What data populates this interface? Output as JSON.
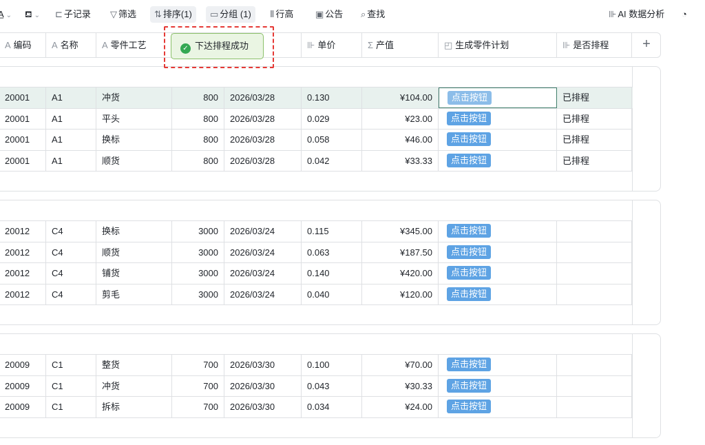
{
  "toolbar": {
    "fill_label": "",
    "subrecord": "子记录",
    "filter": "筛选",
    "sort": "排序(1)",
    "group": "分组 (1)",
    "row_height": "行高",
    "notice": "公告",
    "search": "查找",
    "ai": "AI 数据分析"
  },
  "columns": [
    {
      "icon": "A",
      "label": "编码"
    },
    {
      "icon": "A",
      "label": "名称"
    },
    {
      "icon": "A",
      "label": "零件工艺"
    },
    {
      "icon": "",
      "label": ""
    },
    {
      "icon": "",
      "label": ""
    },
    {
      "icon": "⊪",
      "label": "单价"
    },
    {
      "icon": "Σ",
      "label": "产值"
    },
    {
      "icon": "◰",
      "label": "生成零件计划"
    },
    {
      "icon": "⊪",
      "label": "是否排程"
    }
  ],
  "toast": {
    "text": "下达排程成功"
  },
  "groups": [
    {
      "rows": [
        {
          "code": "20001",
          "name": "A1",
          "process": "冲货",
          "qty": "800",
          "date": "2026/03/28",
          "price": "0.130",
          "value": "¥104.00",
          "button": "点击按钮",
          "status": "已排程"
        },
        {
          "code": "20001",
          "name": "A1",
          "process": "平头",
          "qty": "800",
          "date": "2026/03/28",
          "price": "0.029",
          "value": "¥23.00",
          "button": "点击按钮",
          "status": "已排程"
        },
        {
          "code": "20001",
          "name": "A1",
          "process": "换标",
          "qty": "800",
          "date": "2026/03/28",
          "price": "0.058",
          "value": "¥46.00",
          "button": "点击按钮",
          "status": "已排程"
        },
        {
          "code": "20001",
          "name": "A1",
          "process": "顺货",
          "qty": "800",
          "date": "2026/03/28",
          "price": "0.042",
          "value": "¥33.33",
          "button": "点击按钮",
          "status": "已排程"
        }
      ]
    },
    {
      "rows": [
        {
          "code": "20012",
          "name": "C4",
          "process": "换标",
          "qty": "3000",
          "date": "2026/03/24",
          "price": "0.115",
          "value": "¥345.00",
          "button": "点击按钮",
          "status": ""
        },
        {
          "code": "20012",
          "name": "C4",
          "process": "顺货",
          "qty": "3000",
          "date": "2026/03/24",
          "price": "0.063",
          "value": "¥187.50",
          "button": "点击按钮",
          "status": ""
        },
        {
          "code": "20012",
          "name": "C4",
          "process": "铺货",
          "qty": "3000",
          "date": "2026/03/24",
          "price": "0.140",
          "value": "¥420.00",
          "button": "点击按钮",
          "status": ""
        },
        {
          "code": "20012",
          "name": "C4",
          "process": "剪毛",
          "qty": "3000",
          "date": "2026/03/24",
          "price": "0.040",
          "value": "¥120.00",
          "button": "点击按钮",
          "status": ""
        }
      ]
    },
    {
      "rows": [
        {
          "code": "20009",
          "name": "C1",
          "process": "整货",
          "qty": "700",
          "date": "2026/03/30",
          "price": "0.100",
          "value": "¥70.00",
          "button": "点击按钮",
          "status": ""
        },
        {
          "code": "20009",
          "name": "C1",
          "process": "冲货",
          "qty": "700",
          "date": "2026/03/30",
          "price": "0.043",
          "value": "¥30.33",
          "button": "点击按钮",
          "status": ""
        },
        {
          "code": "20009",
          "name": "C1",
          "process": "拆标",
          "qty": "700",
          "date": "2026/03/30",
          "price": "0.034",
          "value": "¥24.00",
          "button": "点击按钮",
          "status": ""
        }
      ]
    }
  ]
}
